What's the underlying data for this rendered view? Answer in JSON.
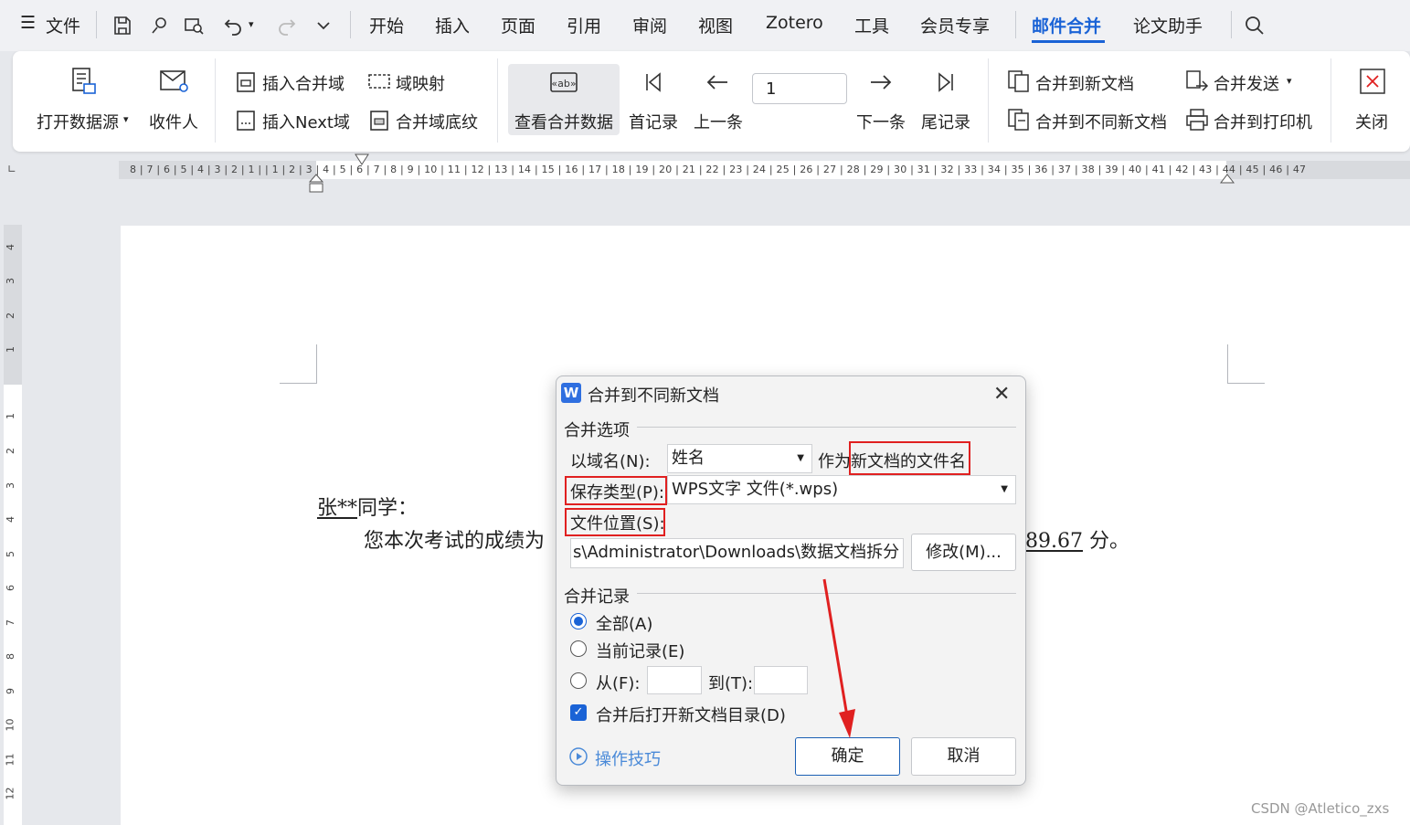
{
  "menubar": {
    "file_label": "文件",
    "tabs": [
      "开始",
      "插入",
      "页面",
      "引用",
      "审阅",
      "视图",
      "Zotero",
      "工具",
      "会员专享",
      "邮件合并",
      "论文助手"
    ],
    "active_tab": "邮件合并"
  },
  "ribbon": {
    "open_datasource": "打开数据源",
    "recipients": "收件人",
    "insert_merge_field": "插入合并域",
    "field_mapping": "域映射",
    "insert_next_field": "插入Next域",
    "merge_field_shading": "合并域底纹",
    "view_merged_data": "查看合并数据",
    "first_record": "首记录",
    "prev_record": "上一条",
    "record_number": "1",
    "next_record": "下一条",
    "last_record": "尾记录",
    "merge_to_new_doc": "合并到新文档",
    "merge_send": "合并发送",
    "merge_to_different_docs": "合并到不同新文档",
    "merge_to_printer": "合并到打印机",
    "close": "关闭"
  },
  "ruler": {
    "horizontal": "8 | 7 | 6 | 5 | 4 | 3 | 2 | 1 |     | 1 | 2 | 3 | 4 | 5 | 6 | 7 | 8 | 9 | 10 | 11 | 12 | 13 | 14 | 15 | 16 | 17 | 18 | 19 | 20 | 21 | 22 | 23 | 24 | 25 | 26 | 27 | 28 | 29 | 30 | 31 | 32 | 33 | 34 | 35 | 36 | 37 | 38 | 39 | 40 | 41 | 42 | 43 | 44 | 45 | 46 | 47",
    "vertical_top": [
      "4",
      "3",
      "2",
      "1"
    ],
    "vertical_bottom": [
      "1",
      "2",
      "3",
      "4",
      "5",
      "6",
      "7",
      "8",
      "9",
      "10",
      "11",
      "12"
    ]
  },
  "document": {
    "name": "张**",
    "greeting_suffix": "同学：",
    "body_start": "您本次考试的成绩为",
    "score": "89.67",
    "body_end": "分。"
  },
  "dialog": {
    "title": "合并到不同新文档",
    "merge_options_group": "合并选项",
    "field_name_label": "以域名(N):",
    "field_name_value": "姓名",
    "as_filename_prefix": "作为",
    "as_filename_highlight": "新文档的文件名",
    "save_type_label": "保存类型(P):",
    "save_type_value": "WPS文字 文件(*.wps)",
    "file_location_label": "文件位置(S):",
    "file_location_value": "s\\Administrator\\Downloads\\数据文档拆分",
    "modify_button": "修改(M)...",
    "merge_records_group": "合并记录",
    "all_label": "全部(A)",
    "current_label": "当前记录(E)",
    "from_label": "从(F):",
    "to_label": "到(T):",
    "open_dir_label": "合并后打开新文档目录(D)",
    "tips_label": "操作技巧",
    "ok_button": "确定",
    "cancel_button": "取消"
  },
  "watermark": "CSDN @Atletico_zxs"
}
